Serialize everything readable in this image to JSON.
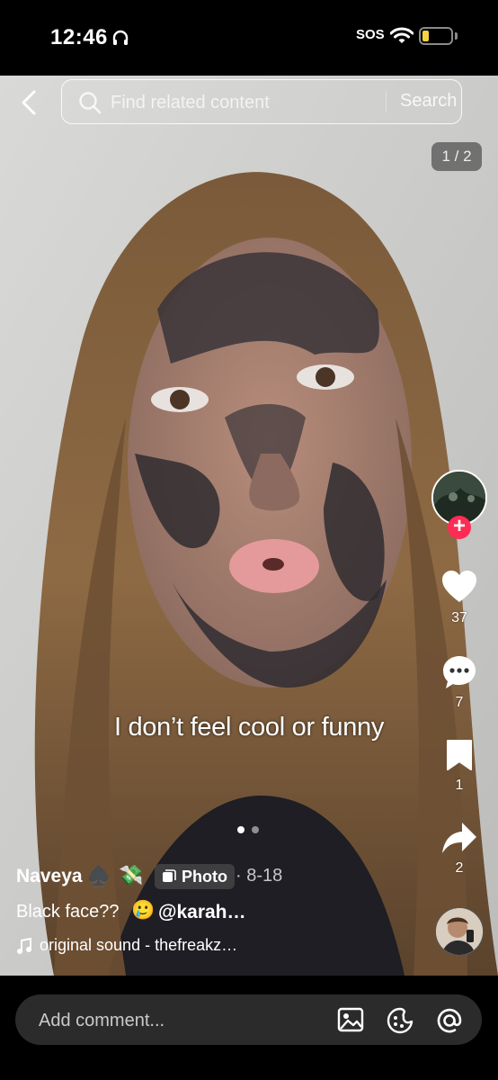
{
  "status_bar": {
    "time": "12:46",
    "sos": "SOS"
  },
  "search": {
    "placeholder": "Find related content",
    "button": "Search"
  },
  "page_counter": "1 / 2",
  "caption_overlay": "I don’t feel cool or funny",
  "carousel": {
    "current": 1,
    "total": 2
  },
  "rail": {
    "likes": "37",
    "comments": "7",
    "saves": "1",
    "shares": "2"
  },
  "post": {
    "username": "Naveya",
    "spade": "♠️",
    "money_emoji": "💸",
    "type_badge": "Photo",
    "date": "· 8-18",
    "description": "Black face??",
    "tear_emoji": "🥲",
    "mention": "@karah…",
    "sound": "original sound - thefreakz…"
  },
  "comment": {
    "placeholder": "Add comment..."
  },
  "colors": {
    "follow": "#fe2c55",
    "battery": "#f3d33f",
    "comment_bar": "#2b2b2b"
  },
  "icons": [
    "back-icon",
    "search-icon",
    "heart-icon",
    "comment-icon",
    "bookmark-icon",
    "share-icon",
    "music-note-icon",
    "image-icon",
    "emoji-icon",
    "at-icon"
  ]
}
